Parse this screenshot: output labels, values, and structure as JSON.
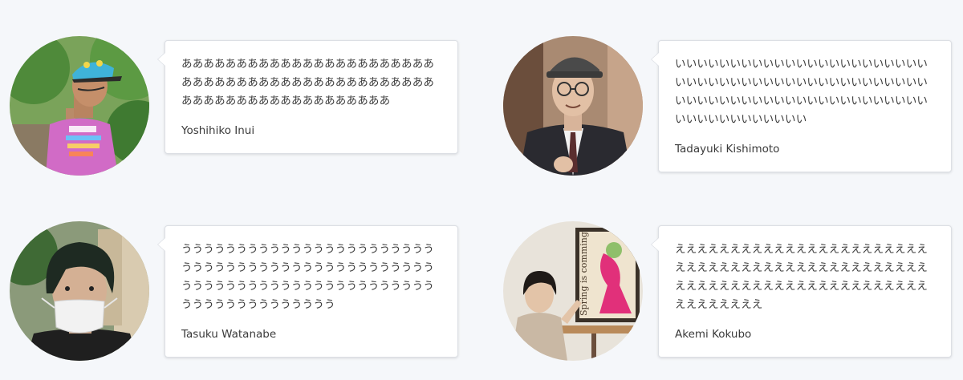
{
  "testimonials": [
    {
      "message": "あああああああああああああああああああああああああああああああああああああああああああああああああああああああああああああああああ",
      "name": "Yoshihiko Inui",
      "avatar_icon": "person-photo-icon"
    },
    {
      "message": "いいいいいいいいいいいいいいいいいいいいいいいいいいいいいいいいいいいいいいいいいいいいいいいいいいいいいいいいいいいいいいいいいいいいいいいいいいいいいいいいい",
      "name": "Tadayuki Kishimoto",
      "avatar_icon": "person-photo-icon"
    },
    {
      "message": "ううううううううううううううううううううううううううううううううううううううううううううううううううううううううううううううううううううううううううううううううううう",
      "name": "Tasuku Watanabe",
      "avatar_icon": "person-photo-icon"
    },
    {
      "message": "えええええええええええええええええええええええええええええええええええええええええええええええええええええええええええええええええええええええええええええ",
      "name": "Akemi Kokubo",
      "avatar_icon": "person-photo-icon"
    }
  ],
  "poster": {
    "text": "Spring is comming"
  }
}
